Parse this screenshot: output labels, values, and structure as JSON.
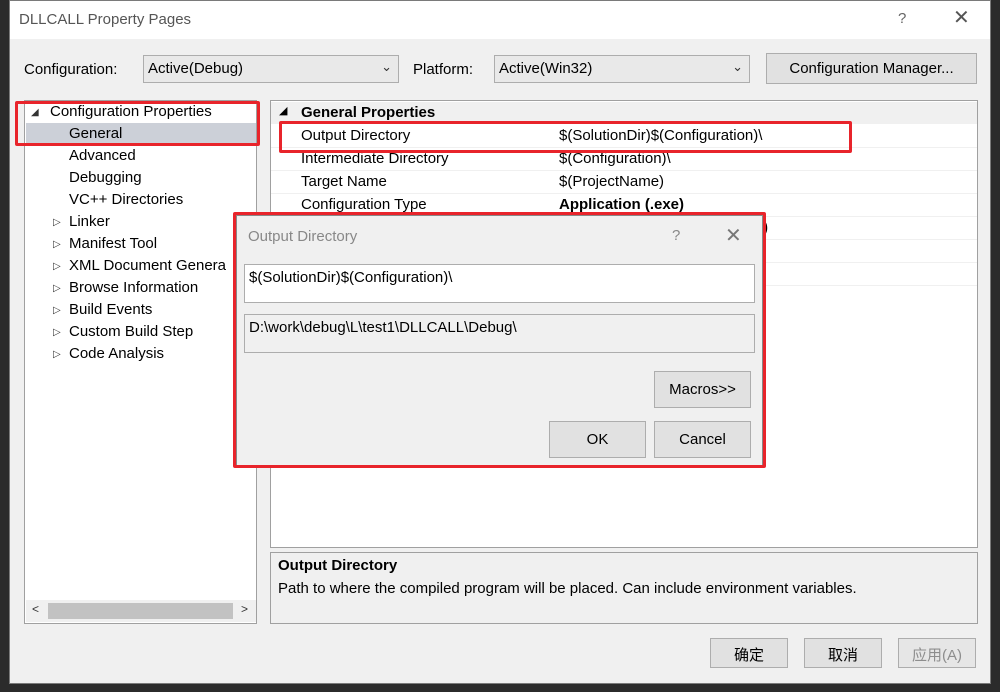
{
  "window": {
    "title": "DLLCALL Property Pages",
    "help_glyph": "?",
    "close_glyph": "✕"
  },
  "toolbar": {
    "configuration_label": "Configuration:",
    "configuration_value": "Active(Debug)",
    "platform_label": "Platform:",
    "platform_value": "Active(Win32)",
    "config_manager_label": "Configuration Manager..."
  },
  "tree": {
    "root": "Configuration Properties",
    "items": [
      {
        "label": "General",
        "expandable": false,
        "selected": true
      },
      {
        "label": "Advanced",
        "expandable": false
      },
      {
        "label": "Debugging",
        "expandable": false
      },
      {
        "label": "VC++ Directories",
        "expandable": false
      },
      {
        "label": "Linker",
        "expandable": true
      },
      {
        "label": "Manifest Tool",
        "expandable": true
      },
      {
        "label": "XML Document Genera",
        "expandable": true
      },
      {
        "label": "Browse Information",
        "expandable": true
      },
      {
        "label": "Build Events",
        "expandable": true
      },
      {
        "label": "Custom Build Step",
        "expandable": true
      },
      {
        "label": "Code Analysis",
        "expandable": true
      }
    ]
  },
  "grid": {
    "section": "General Properties",
    "rows": [
      {
        "name": "Output Directory",
        "value": "$(SolutionDir)$(Configuration)\\"
      },
      {
        "name": "Intermediate Directory",
        "value": "$(Configuration)\\"
      },
      {
        "name": "Target Name",
        "value": "$(ProjectName)"
      },
      {
        "name": "Configuration Type",
        "value": "Application (.exe)"
      },
      {
        "name": "",
        "value": ")"
      }
    ]
  },
  "description": {
    "title": "Output Directory",
    "text": "Path to where the compiled program will be placed. Can include environment variables."
  },
  "buttons": {
    "ok": "确定",
    "cancel": "取消",
    "apply": "应用(A)"
  },
  "dialog": {
    "title": "Output Directory",
    "help_glyph": "?",
    "close_glyph": "✕",
    "edit_value": "$(SolutionDir)$(Configuration)\\",
    "evaluated_value": "D:\\work\\debug\\L\\test1\\DLLCALL\\Debug\\",
    "macros_label": "Macros>>",
    "ok_label": "OK",
    "cancel_label": "Cancel"
  },
  "colors": {
    "highlight": "#e8242b",
    "selection": "#ccd0d8"
  }
}
